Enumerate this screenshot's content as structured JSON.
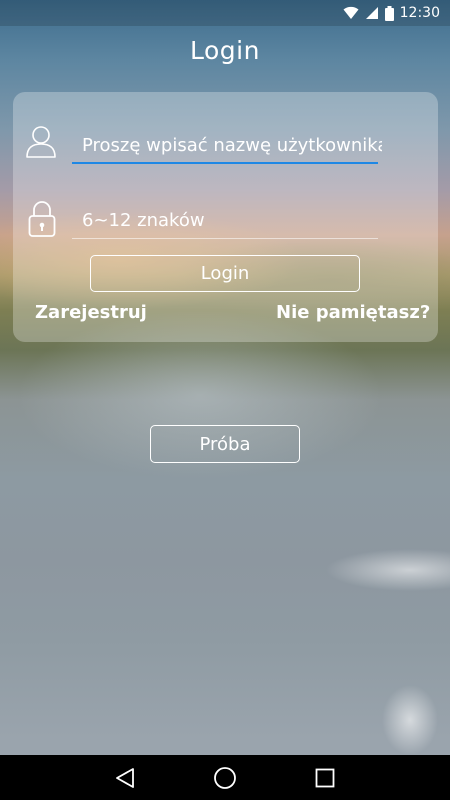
{
  "status_bar": {
    "time": "12:30",
    "icons": [
      "wifi-icon",
      "cell-signal-icon",
      "battery-icon"
    ]
  },
  "screen": {
    "title": "Login"
  },
  "login_form": {
    "username": {
      "icon": "user-icon",
      "placeholder": "Proszę wpisać nazwę użytkownika",
      "value": ""
    },
    "password": {
      "icon": "lock-icon",
      "placeholder": "6~12 znaków",
      "value": ""
    },
    "login_button": "Login",
    "register_link": "Zarejestruj",
    "forgot_link": "Nie pamiętasz?"
  },
  "trial_button": "Próba",
  "nav_bar": {
    "buttons": [
      "back-icon",
      "home-icon",
      "recents-icon"
    ]
  },
  "colors": {
    "focused_underline": "#1e88e5",
    "field_underline": "rgba(255,255,255,0.55)",
    "text": "#ffffff",
    "nav_background": "#000000"
  }
}
